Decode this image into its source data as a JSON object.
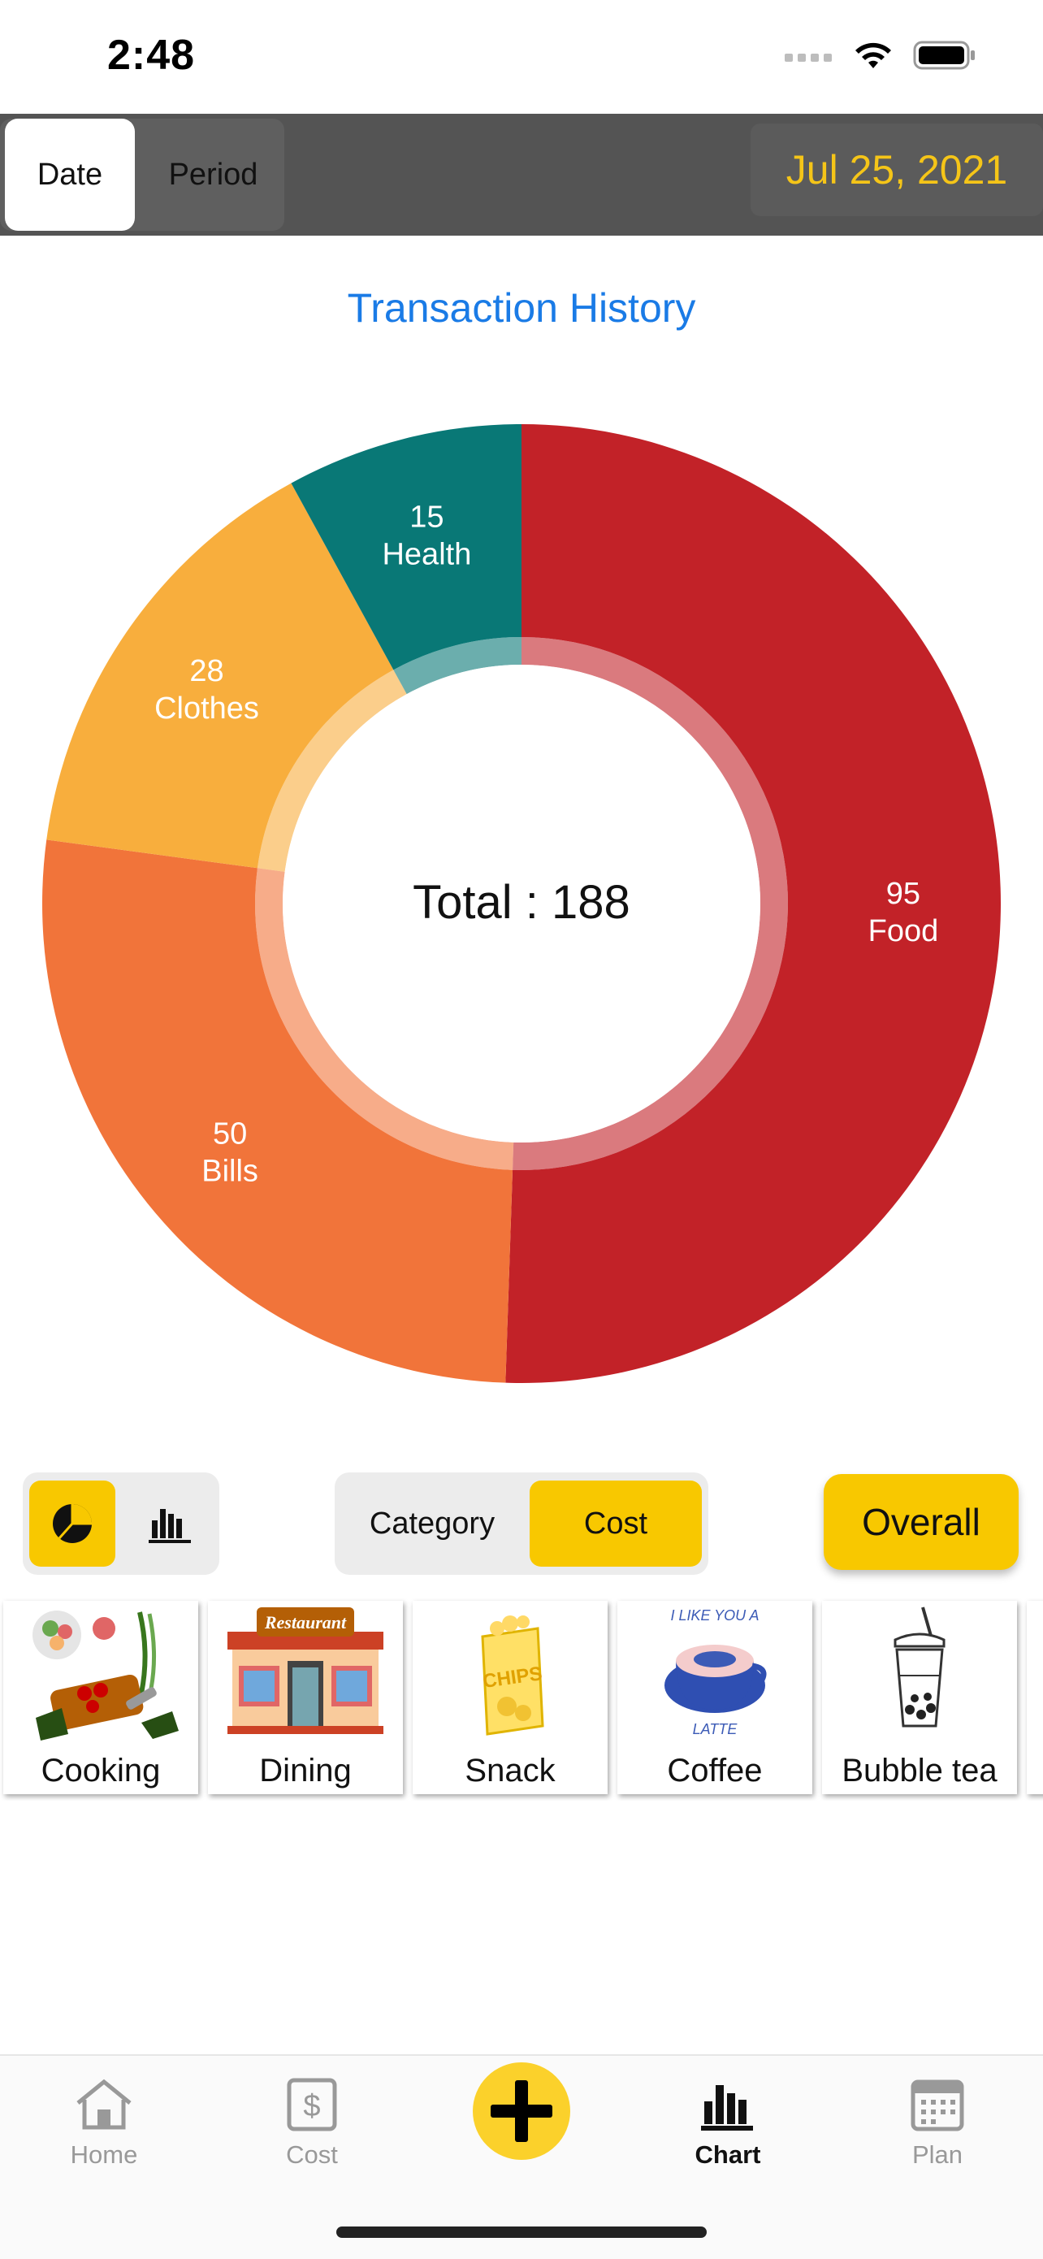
{
  "status": {
    "time": "2:48"
  },
  "toolbar": {
    "date_label": "Date",
    "period_label": "Period",
    "selected_date": "Jul 25, 2021"
  },
  "chart_title": "Transaction History",
  "chart_data": {
    "type": "pie",
    "title": "Transaction History",
    "center_label": "Total : 188",
    "total": 188,
    "slices": [
      {
        "name": "Food",
        "value": 95,
        "color": "#c22228"
      },
      {
        "name": "Bills",
        "value": 50,
        "color": "#f1743a"
      },
      {
        "name": "Clothes",
        "value": 28,
        "color": "#f8ae3d"
      },
      {
        "name": "Health",
        "value": 15,
        "color": "#097876"
      }
    ]
  },
  "controls": {
    "chart_type_icons": [
      "pie-chart-icon",
      "bar-chart-icon"
    ],
    "selected_chart_type": "pie",
    "sort_category": "Category",
    "sort_cost": "Cost",
    "selected_sort": "Cost",
    "overall": "Overall"
  },
  "categories": [
    {
      "label": "Cooking",
      "icon": "cooking-icon"
    },
    {
      "label": "Dining",
      "icon": "restaurant-icon"
    },
    {
      "label": "Snack",
      "icon": "chips-icon"
    },
    {
      "label": "Coffee",
      "icon": "latte-icon"
    },
    {
      "label": "Bubble tea",
      "icon": "bubble-tea-icon"
    }
  ],
  "restaurant_sign": "Restaurant",
  "chips_text": "CHIPS",
  "latte_top": "I LIKE YOU A",
  "latte_bottom": "LATTE",
  "tabs": [
    {
      "label": "Home",
      "icon": "home-icon"
    },
    {
      "label": "Cost",
      "icon": "dollar-icon"
    },
    {
      "label": "",
      "icon": "plus-icon"
    },
    {
      "label": "Chart",
      "icon": "bar-chart-icon",
      "active": true
    },
    {
      "label": "Plan",
      "icon": "calendar-icon"
    }
  ],
  "colors": {
    "accent": "#f8c800",
    "link": "#1a7be6",
    "toolbar": "#545454",
    "date_text": "#f5c518"
  }
}
